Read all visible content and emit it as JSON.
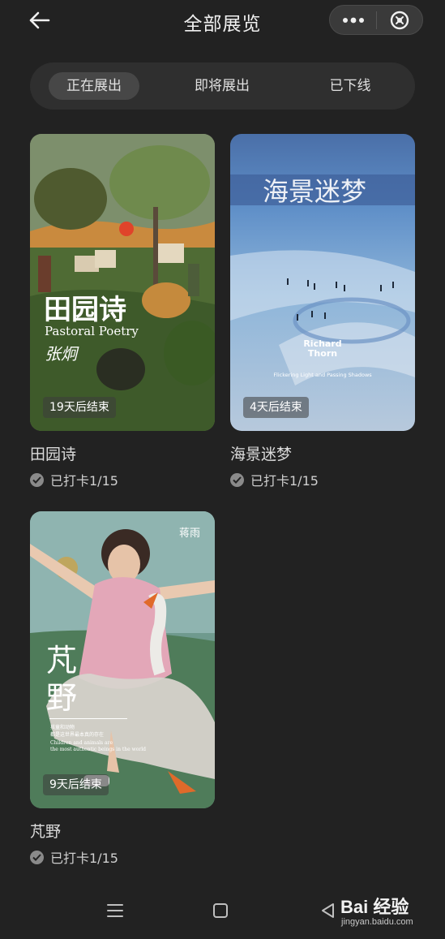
{
  "header": {
    "title": "全部展览"
  },
  "tabs": [
    {
      "label": "正在展出",
      "active": true
    },
    {
      "label": "即将展出",
      "active": false
    },
    {
      "label": "已下线",
      "active": false
    }
  ],
  "exhibitions": [
    {
      "title": "田园诗",
      "checkin": "已打卡1/15",
      "badge": "19天后结束",
      "poster_title": "田园诗",
      "poster_subtitle": "Pastoral Poetry",
      "poster_artist": "张炯"
    },
    {
      "title": "海景迷梦",
      "checkin": "已打卡1/15",
      "badge": "4天后结束",
      "poster_title": "海景迷梦",
      "poster_artist_en_1": "Richard",
      "poster_artist_en_2": "Thorn",
      "poster_tagline": "Flickering Light and Passing Shadows"
    },
    {
      "title": "芃野",
      "checkin": "已打卡1/15",
      "badge": "9天后结束",
      "poster_title_1": "芃",
      "poster_title_2": "野",
      "poster_artist": "蒋雨",
      "poster_note_cn_1": "孩童和动物",
      "poster_note_cn_2": "都是这世界最本真的存在",
      "poster_note_en_1": "Children and animals are",
      "poster_note_en_2": "the most authentic beings in the world"
    }
  ],
  "watermark": {
    "main": "Bai 经验",
    "sub": "jingyan.baidu.com"
  }
}
